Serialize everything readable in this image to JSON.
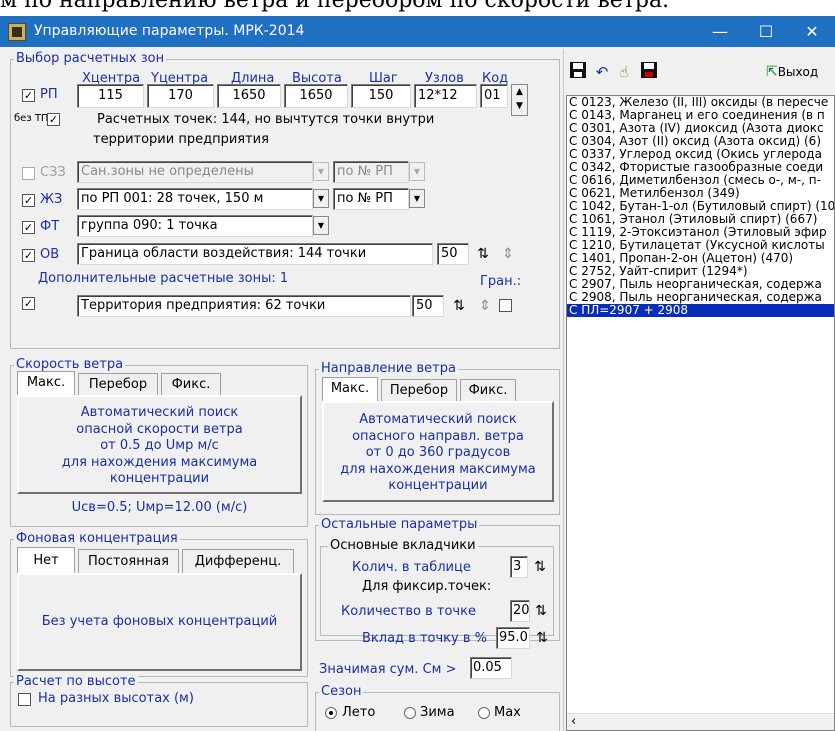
{
  "cut_text": "м по направлению ветра и перебором по скорости ветра.",
  "window": {
    "title": "Управляющие параметры. МРК-2014",
    "minimize": "—",
    "maximize": "☐",
    "close": "✕"
  },
  "zones": {
    "group_label": "Выбор расчетных зон",
    "headers": {
      "xc": "Xцентра",
      "yc": "Yцентра",
      "len": "Длина",
      "height": "Высота",
      "step": "Шаг",
      "nodes": "Узлов",
      "code": "Код"
    },
    "rp": {
      "label": "РП",
      "xc": "115",
      "yc": "170",
      "len": "1650",
      "height": "1650",
      "step": "150",
      "nodes": "12*12",
      "code": "01"
    },
    "bez_tp": "без ТП",
    "info_line1": "Расчетных точек: 144, но вычтутся точки внутри",
    "info_line2": "территории предприятия",
    "szz": {
      "label": "СЗЗ",
      "value": "Сан.зоны не определены",
      "by": "по № РП"
    },
    "zhz": {
      "label": "ЖЗ",
      "value": "по РП 001: 28 точек, 150 м",
      "by": "по № РП"
    },
    "ft": {
      "label": "ФТ",
      "value": "группа 090:   1 точка"
    },
    "ov": {
      "label": "ОВ",
      "value": "Граница области воздействия: 144 точки",
      "num": "50"
    },
    "additional": "Дополнительные расчетные зоны: 1",
    "gran": "Гран.:",
    "territory": {
      "value": "Территория предприятия: 62 точки",
      "num": "50"
    }
  },
  "wind_speed": {
    "group_label": "Скорость ветра",
    "tabs": [
      "Макс.",
      "Перебор",
      "Фикс."
    ],
    "panel_lines": [
      "Автоматический поиск",
      "опасной скорости ветра",
      "от 0.5 до Uмр м/с",
      "для нахождения максимума",
      "концентрации"
    ],
    "footer": "Uсв=0.5; Uмр=12.00 (м/с)"
  },
  "wind_dir": {
    "group_label": "Направление ветра",
    "tabs": [
      "Макс.",
      "Перебор",
      "Фикс."
    ],
    "panel_lines": [
      "Автоматический поиск",
      "опасного направл. ветра",
      "от 0 до 360 градусов",
      "для нахождения максимума",
      "концентрации"
    ]
  },
  "background": {
    "group_label": "Фоновая концентрация",
    "tabs": [
      "Нет",
      "Постоянная",
      "Дифференц."
    ],
    "panel_text": "Без учета фоновых концентраций"
  },
  "other": {
    "group_label": "Остальные параметры",
    "main_contrib": "Основные вкладчики",
    "count_in_table": "Колич. в таблице",
    "count_in_table_val": "3",
    "for_fixed": "Для фиксир.точек:",
    "count_in_point": "Количество в точке",
    "count_in_point_val": "20",
    "contrib_pct": "Вклад в точку в %",
    "contrib_pct_val": "95.0",
    "significant": "Значимая сум. См >",
    "significant_val": "0.05"
  },
  "height_calc": {
    "group_label": "Расчет по высоте",
    "checkbox": "На разных высотах (м)"
  },
  "season": {
    "group_label": "Сезон",
    "options": [
      "Лето",
      "Зима",
      "Max"
    ]
  },
  "toolbar": {
    "exit": "Выход"
  },
  "substances": [
    "С  0123, Железо (II, III) оксиды (в пересче",
    "С  0143, Марганец и его соединения (в п",
    "С  0301, Азота (IV) диоксид (Азота диокс",
    "С  0304, Азот (II) оксид (Азота оксид) (6)",
    "С  0337, Углерод оксид (Окись углерода",
    "С  0342, Фтористые газообразные соеди",
    "С  0616, Диметилбензол (смесь о-, м-, п-",
    "С  0621, Метилбензол (349)",
    "С  1042, Бутан-1-ол (Бутиловый спирт) (10",
    "С  1061, Этанол (Этиловый спирт) (667)",
    "С  1119, 2-Этоксиэтанол (Этиловый эфир",
    "С  1210, Бутилацетат (Уксусной кислоты",
    "С  1401, Пропан-2-он (Ацетон) (470)",
    "С  2752, Уайт-спирит (1294*)",
    "С  2907, Пыль неорганическая, содержа",
    "С  2908, Пыль неорганическая, содержа",
    "С      ПЛ=2907 + 2908"
  ],
  "colors": {
    "title_bar": "#1f6fc2",
    "label_blue": "#1a2fa6",
    "selection": "#0a2db8"
  }
}
